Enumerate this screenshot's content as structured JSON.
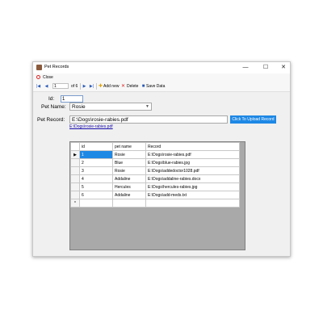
{
  "window": {
    "title": "Pet Records"
  },
  "titlebar_buttons": {
    "minimize": "—",
    "maximize": "☐",
    "close": "✕"
  },
  "menu": {
    "close_label": "Close"
  },
  "navigator": {
    "first": "|◀",
    "prev": "◀",
    "position": "1",
    "of_text": "of 6",
    "next": "▶",
    "last": "▶|",
    "add_label": "Add new",
    "delete_label": "Delete",
    "save_label": "Save Data"
  },
  "form": {
    "id_label": "Id:",
    "id_value": "1",
    "name_label": "Pet Name:",
    "name_value": "Rosie",
    "record_label": "Pet Record:",
    "record_value": "E:\\Dogs\\rosie-rabies.pdf",
    "upload_label": "Click To Upload Record",
    "link_text": "E:\\Dogs\\rosie-rabies.pdf"
  },
  "grid": {
    "headers": [
      "id",
      "pet name",
      "Record"
    ],
    "rows": [
      {
        "id": "1",
        "pet_name": "Rosie",
        "record": "E:\\Dogs\\rosie-rabies.pdf"
      },
      {
        "id": "2",
        "pet_name": "Blue",
        "record": "E:\\Dogs\\blue-rabies.jpg"
      },
      {
        "id": "3",
        "pet_name": "Rosie",
        "record": "E:\\Dogs\\addedoctor1028.pdf"
      },
      {
        "id": "4",
        "pet_name": "Addaline",
        "record": "E:\\Dogs\\addaline-rabies.docx"
      },
      {
        "id": "5",
        "pet_name": "Hercules",
        "record": "E:\\Dogs\\hercules-rabies.jpg"
      },
      {
        "id": "6",
        "pet_name": "Addaline",
        "record": "E:\\Dogs\\add-meds.txt"
      }
    ],
    "current_marker": "▶",
    "new_row_marker": "*"
  },
  "colors": {
    "accent": "#1e88e5",
    "grid_background": "#a9a9a9"
  }
}
